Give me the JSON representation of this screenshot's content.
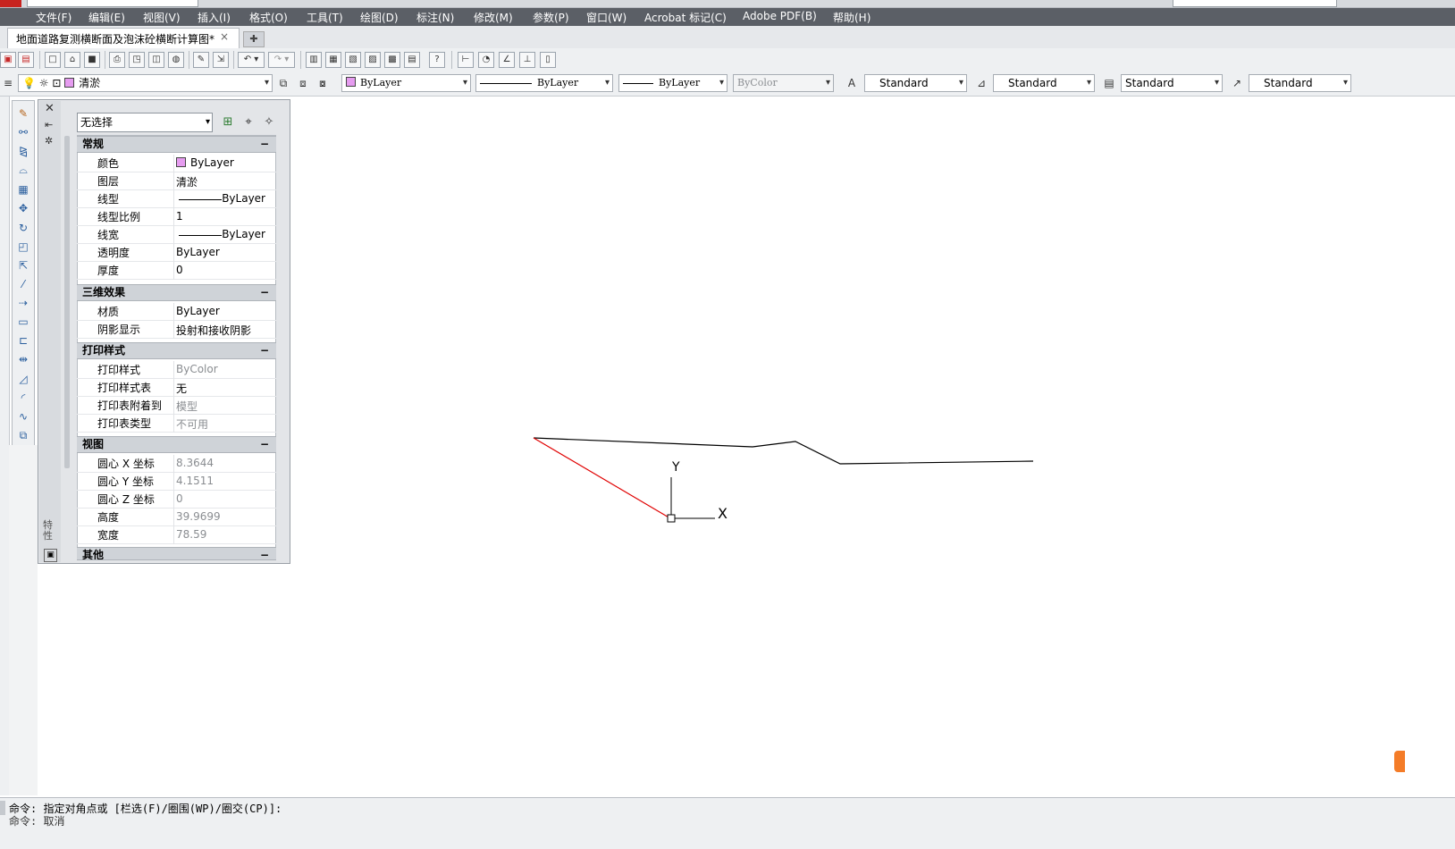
{
  "window": {
    "active_tab_title": "地面道路复测横断面及泡沫砼横断计算图*",
    "tab_close_glyph": "×",
    "new_tab_glyph": "✚"
  },
  "menu": [
    "文件(F)",
    "编辑(E)",
    "视图(V)",
    "插入(I)",
    "格式(O)",
    "工具(T)",
    "绘图(D)",
    "标注(N)",
    "修改(M)",
    "参数(P)",
    "窗口(W)",
    "Acrobat 标记(C)",
    "Adobe PDF(B)",
    "帮助(H)"
  ],
  "toolbar": {
    "layer_name": "清淤",
    "color": "ByLayer",
    "linetype": "ByLayer",
    "lineweight": "ByLayer",
    "plot_style": "ByColor",
    "text_style": "Standard",
    "dim_style": "Standard",
    "table_style": "Standard",
    "multileader_style": "Standard",
    "help_glyph": "?"
  },
  "properties": {
    "selection": "无选择",
    "vertical_title": "特性",
    "collapse_glyph": "−",
    "sections": {
      "general": {
        "title": "常规",
        "rows": {
          "color": {
            "label": "颜色",
            "value": "ByLayer"
          },
          "layer": {
            "label": "图层",
            "value": "清淤"
          },
          "linetype": {
            "label": "线型",
            "value": "ByLayer"
          },
          "linetype_scale": {
            "label": "线型比例",
            "value": "1"
          },
          "lineweight": {
            "label": "线宽",
            "value": "ByLayer"
          },
          "transparency": {
            "label": "透明度",
            "value": "ByLayer"
          },
          "thickness": {
            "label": "厚度",
            "value": "0"
          }
        }
      },
      "3d": {
        "title": "三维效果",
        "rows": {
          "material": {
            "label": "材质",
            "value": "ByLayer"
          },
          "shadow": {
            "label": "阴影显示",
            "value": "投射和接收阴影"
          }
        }
      },
      "plot": {
        "title": "打印样式",
        "rows": {
          "plot_style": {
            "label": "打印样式",
            "value": "ByColor"
          },
          "plot_table": {
            "label": "打印样式表",
            "value": "无"
          },
          "attached_to": {
            "label": "打印表附着到",
            "value": "模型"
          },
          "table_type": {
            "label": "打印表类型",
            "value": "不可用"
          }
        }
      },
      "view": {
        "title": "视图",
        "rows": {
          "center_x": {
            "label": "圆心 X 坐标",
            "value": "8.3644"
          },
          "center_y": {
            "label": "圆心 Y 坐标",
            "value": "4.1511"
          },
          "center_z": {
            "label": "圆心 Z 坐标",
            "value": "0"
          },
          "height": {
            "label": "高度",
            "value": "39.9699"
          },
          "width": {
            "label": "宽度",
            "value": "78.59"
          }
        }
      },
      "misc": {
        "title": "其他"
      }
    }
  },
  "canvas": {
    "ucs_x": "X",
    "ucs_y": "Y",
    "line_colors": {
      "profile": "#000000",
      "slope": "#e00000"
    }
  },
  "command": {
    "line1": "命令: 指定对角点或 [栏选(F)/圈围(WP)/圈交(CP)]:",
    "line2": "命令: 取消"
  }
}
